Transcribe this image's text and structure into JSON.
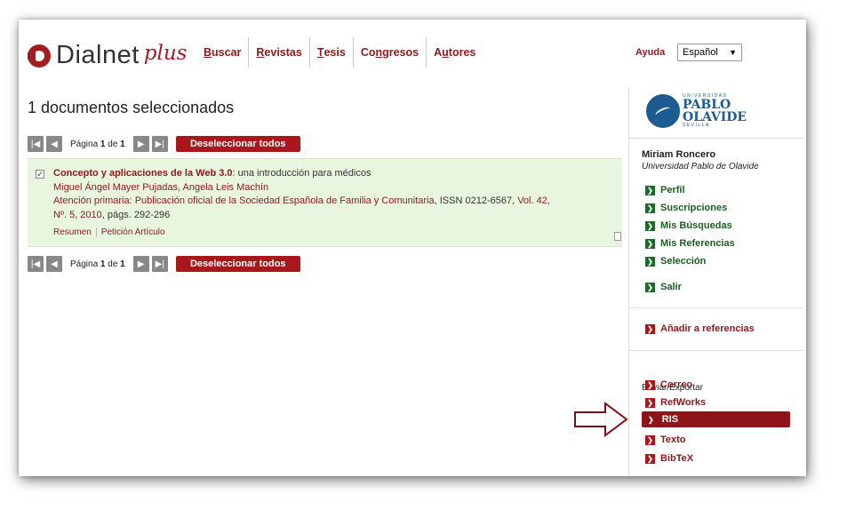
{
  "header": {
    "logo_text": "Dialnet",
    "logo_plus": "plus",
    "nav": [
      {
        "label": "Buscar",
        "key": "B"
      },
      {
        "label": "Revistas",
        "key": "R"
      },
      {
        "label": "Tesis",
        "key": "T"
      },
      {
        "label": "Congresos",
        "key": "n"
      },
      {
        "label": "Autores",
        "key": "u"
      }
    ],
    "help": "Ayuda",
    "language": "Español"
  },
  "main": {
    "title": "1 documentos seleccionados",
    "pager": {
      "page_label": "Página",
      "page": "1",
      "of_label": "de",
      "total": "1",
      "deselect_label": "Deseleccionar todos"
    },
    "result": {
      "checked": true,
      "title": "Concepto y aplicaciones de la Web 3.0",
      "subtitle": ": una introducción para médicos",
      "authors": "Miguel Ángel Mayer Pujadas, Angela Leis Machín",
      "source_journal": "Atención primaria: Publicación oficial de la Sociedad Española de Familia y Comunitaria",
      "source_issn": ", ISSN 0212-6567, ",
      "source_vol": "Vol. 42,",
      "source_num": "Nº. 5, 2010",
      "source_pages": ", págs. 292-296",
      "link_summary": "Resumen",
      "link_request": "Petición Artículo"
    }
  },
  "sidebar": {
    "university": {
      "small": "UNIVERSIDAD",
      "big1": "PABLO",
      "big2": "OLAVIDE",
      "city": "SEVILLA"
    },
    "user_name": "Miriam Roncero",
    "user_org": "Universidad Pablo de Olavide",
    "user_links": [
      "Perfil",
      "Suscripciones",
      "Mis Búsquedas",
      "Mis Referencias",
      "Selección",
      "Salir"
    ],
    "add_refs": "Añadir a referencias",
    "export_heading": "Enviar/Exportar",
    "export_links": [
      "Correo",
      "RefWorks",
      "RIS",
      "Texto",
      "BibTeX"
    ]
  },
  "colors": {
    "brand": "#a11d21",
    "green": "#1b6b2a",
    "result_bg": "#e8f5df"
  }
}
